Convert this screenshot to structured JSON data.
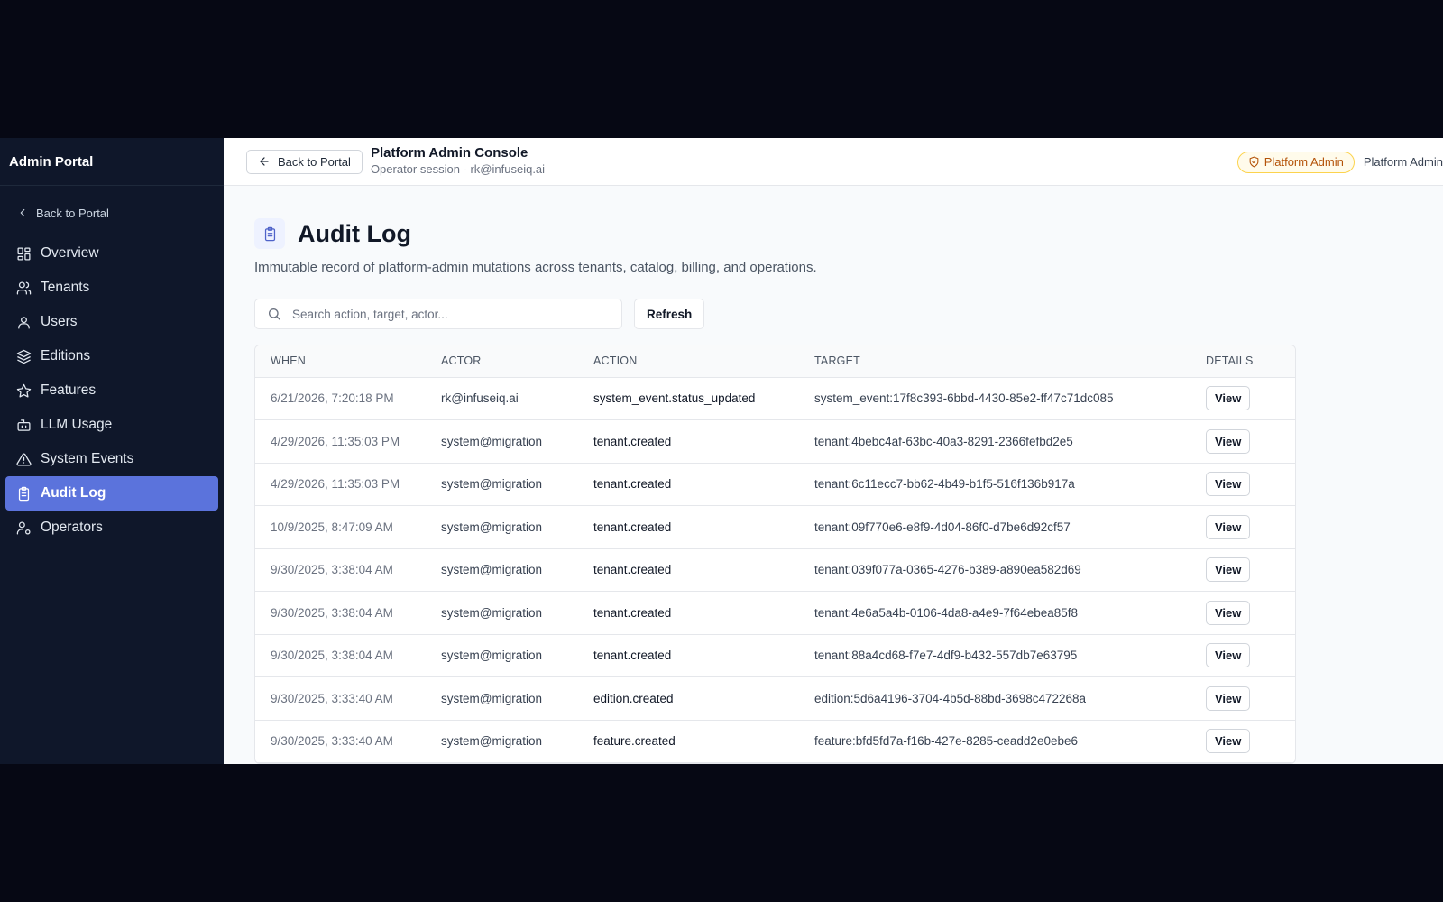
{
  "sidebar": {
    "title": "Admin Portal",
    "back_label": "Back to Portal",
    "items": [
      {
        "label": "Overview",
        "icon": "dashboard-icon"
      },
      {
        "label": "Tenants",
        "icon": "users-icon"
      },
      {
        "label": "Users",
        "icon": "user-icon"
      },
      {
        "label": "Editions",
        "icon": "layers-icon"
      },
      {
        "label": "Features",
        "icon": "star-icon"
      },
      {
        "label": "LLM Usage",
        "icon": "bot-icon"
      },
      {
        "label": "System Events",
        "icon": "alert-triangle-icon"
      },
      {
        "label": "Audit Log",
        "icon": "clipboard-icon",
        "active": true
      },
      {
        "label": "Operators",
        "icon": "user-cog-icon"
      }
    ]
  },
  "topbar": {
    "back_label": "Back to Portal",
    "title": "Platform Admin Console",
    "session": "Operator session - rk@infuseiq.ai",
    "badge": "Platform Admin",
    "role_text": "Platform Admin"
  },
  "page": {
    "title": "Audit Log",
    "subtitle": "Immutable record of platform-admin mutations across tenants, catalog, billing, and operations.",
    "search_placeholder": "Search action, target, actor...",
    "refresh_label": "Refresh"
  },
  "table": {
    "headers": [
      "WHEN",
      "ACTOR",
      "ACTION",
      "TARGET",
      "DETAILS"
    ],
    "view_label": "View",
    "rows": [
      {
        "when": "6/21/2026, 7:20:18 PM",
        "actor": "rk@infuseiq.ai",
        "action": "system_event.status_updated",
        "target": "system_event:17f8c393-6bbd-4430-85e2-ff47c71dc085"
      },
      {
        "when": "4/29/2026, 11:35:03 PM",
        "actor": "system@migration",
        "action": "tenant.created",
        "target": "tenant:4bebc4af-63bc-40a3-8291-2366fefbd2e5"
      },
      {
        "when": "4/29/2026, 11:35:03 PM",
        "actor": "system@migration",
        "action": "tenant.created",
        "target": "tenant:6c11ecc7-bb62-4b49-b1f5-516f136b917a"
      },
      {
        "when": "10/9/2025, 8:47:09 AM",
        "actor": "system@migration",
        "action": "tenant.created",
        "target": "tenant:09f770e6-e8f9-4d04-86f0-d7be6d92cf57"
      },
      {
        "when": "9/30/2025, 3:38:04 AM",
        "actor": "system@migration",
        "action": "tenant.created",
        "target": "tenant:039f077a-0365-4276-b389-a890ea582d69"
      },
      {
        "when": "9/30/2025, 3:38:04 AM",
        "actor": "system@migration",
        "action": "tenant.created",
        "target": "tenant:4e6a5a4b-0106-4da8-a4e9-7f64ebea85f8"
      },
      {
        "when": "9/30/2025, 3:38:04 AM",
        "actor": "system@migration",
        "action": "tenant.created",
        "target": "tenant:88a4cd68-f7e7-4df9-b432-557db7e63795"
      },
      {
        "when": "9/30/2025, 3:33:40 AM",
        "actor": "system@migration",
        "action": "edition.created",
        "target": "edition:5d6a4196-3704-4b5d-88bd-3698c472268a"
      },
      {
        "when": "9/30/2025, 3:33:40 AM",
        "actor": "system@migration",
        "action": "feature.created",
        "target": "feature:bfd5fd7a-f16b-427e-8285-ceadd2e0ebe6"
      }
    ]
  },
  "colors": {
    "sidebar_bg": "#0f172a",
    "active_item": "#5b73dc",
    "badge_text": "#b45309"
  }
}
